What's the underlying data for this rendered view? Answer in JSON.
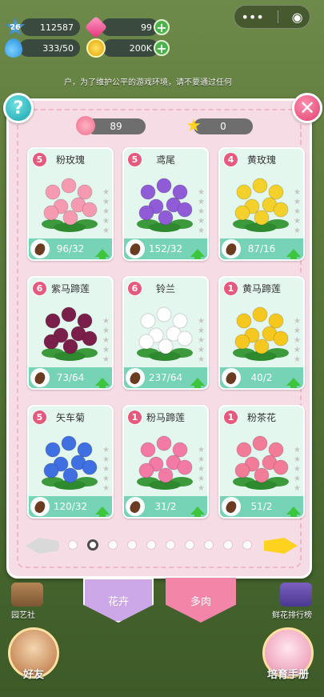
{
  "hud": {
    "level": "26",
    "exp": "112587",
    "gems": "99",
    "water": "333/50",
    "coins": "200K"
  },
  "notice": "户，为了维护公平的游戏环境，请不要通过任何",
  "panel": {
    "petals": "89",
    "stars": "0",
    "flowers": [
      {
        "level": "5",
        "name": "粉玫瑰",
        "count": "96/32",
        "color": "#f59ab0"
      },
      {
        "level": "5",
        "name": "鸢尾",
        "count": "152/32",
        "color": "#8f5bd6"
      },
      {
        "level": "4",
        "name": "黄玫瑰",
        "count": "87/16",
        "color": "#f4d02a"
      },
      {
        "level": "6",
        "name": "紫马蹄莲",
        "count": "73/64",
        "color": "#7a1f4a"
      },
      {
        "level": "6",
        "name": "铃兰",
        "count": "237/64",
        "color": "#ffffff"
      },
      {
        "level": "1",
        "name": "黄马蹄莲",
        "count": "40/2",
        "color": "#f6c71e"
      },
      {
        "level": "5",
        "name": "矢车菊",
        "count": "120/32",
        "color": "#3f6fe0"
      },
      {
        "level": "1",
        "name": "粉马蹄莲",
        "count": "31/2",
        "color": "#f27aa5"
      },
      {
        "level": "1",
        "name": "粉茶花",
        "count": "51/2",
        "color": "#f27b98"
      }
    ]
  },
  "tabs": [
    "花卉",
    "多肉"
  ],
  "bottom": {
    "garden_club": "园艺社",
    "rank": "鲜花排行榜",
    "friends": "好友",
    "handbook": "培育手册"
  },
  "pagination": {
    "pages": 10,
    "current": 2
  }
}
